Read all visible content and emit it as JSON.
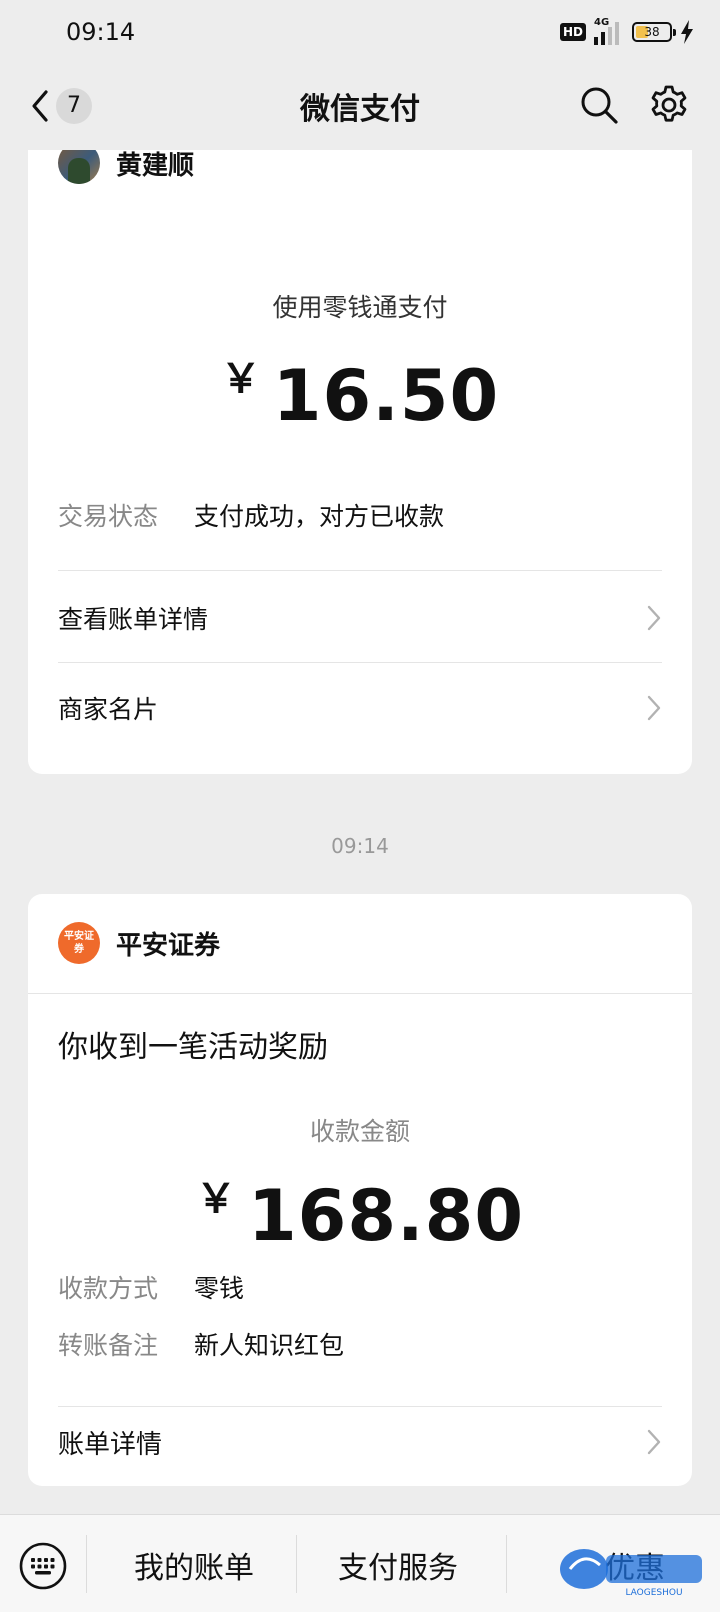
{
  "status_bar": {
    "time": "09:14",
    "hd": "HD",
    "network": "4G",
    "battery": "38",
    "battery_level": 0.38
  },
  "nav": {
    "unread_count": "7",
    "title": "微信支付",
    "icons": [
      "back-icon",
      "search-icon",
      "gear-icon"
    ]
  },
  "card1": {
    "merchant": "黄建顺",
    "pay_method": "使用零钱通支付",
    "currency": "￥",
    "amount": "16.50",
    "status_key": "交易状态",
    "status_value": "支付成功，对方已收款",
    "links": [
      {
        "label": "查看账单详情"
      },
      {
        "label": "商家名片"
      }
    ]
  },
  "time_separator": "09:14",
  "card2": {
    "merchant": "平安证券",
    "logo_text": "平安证券",
    "headline": "你收到一笔活动奖励",
    "amount_label": "收款金额",
    "currency": "￥",
    "amount": "168.80",
    "rows": [
      {
        "key": "收款方式",
        "value": "零钱"
      },
      {
        "key": "转账备注",
        "value": "新人知识红包"
      }
    ],
    "link": "账单详情"
  },
  "bottom_bar": {
    "items": [
      "我的账单",
      "支付服务",
      "优惠"
    ],
    "watermark": "LAOGESHOU"
  },
  "colors": {
    "background": "#ededed",
    "card": "#ffffff",
    "pingan_orange": "#ef6a2b",
    "battery_fill": "#f2c14e"
  }
}
